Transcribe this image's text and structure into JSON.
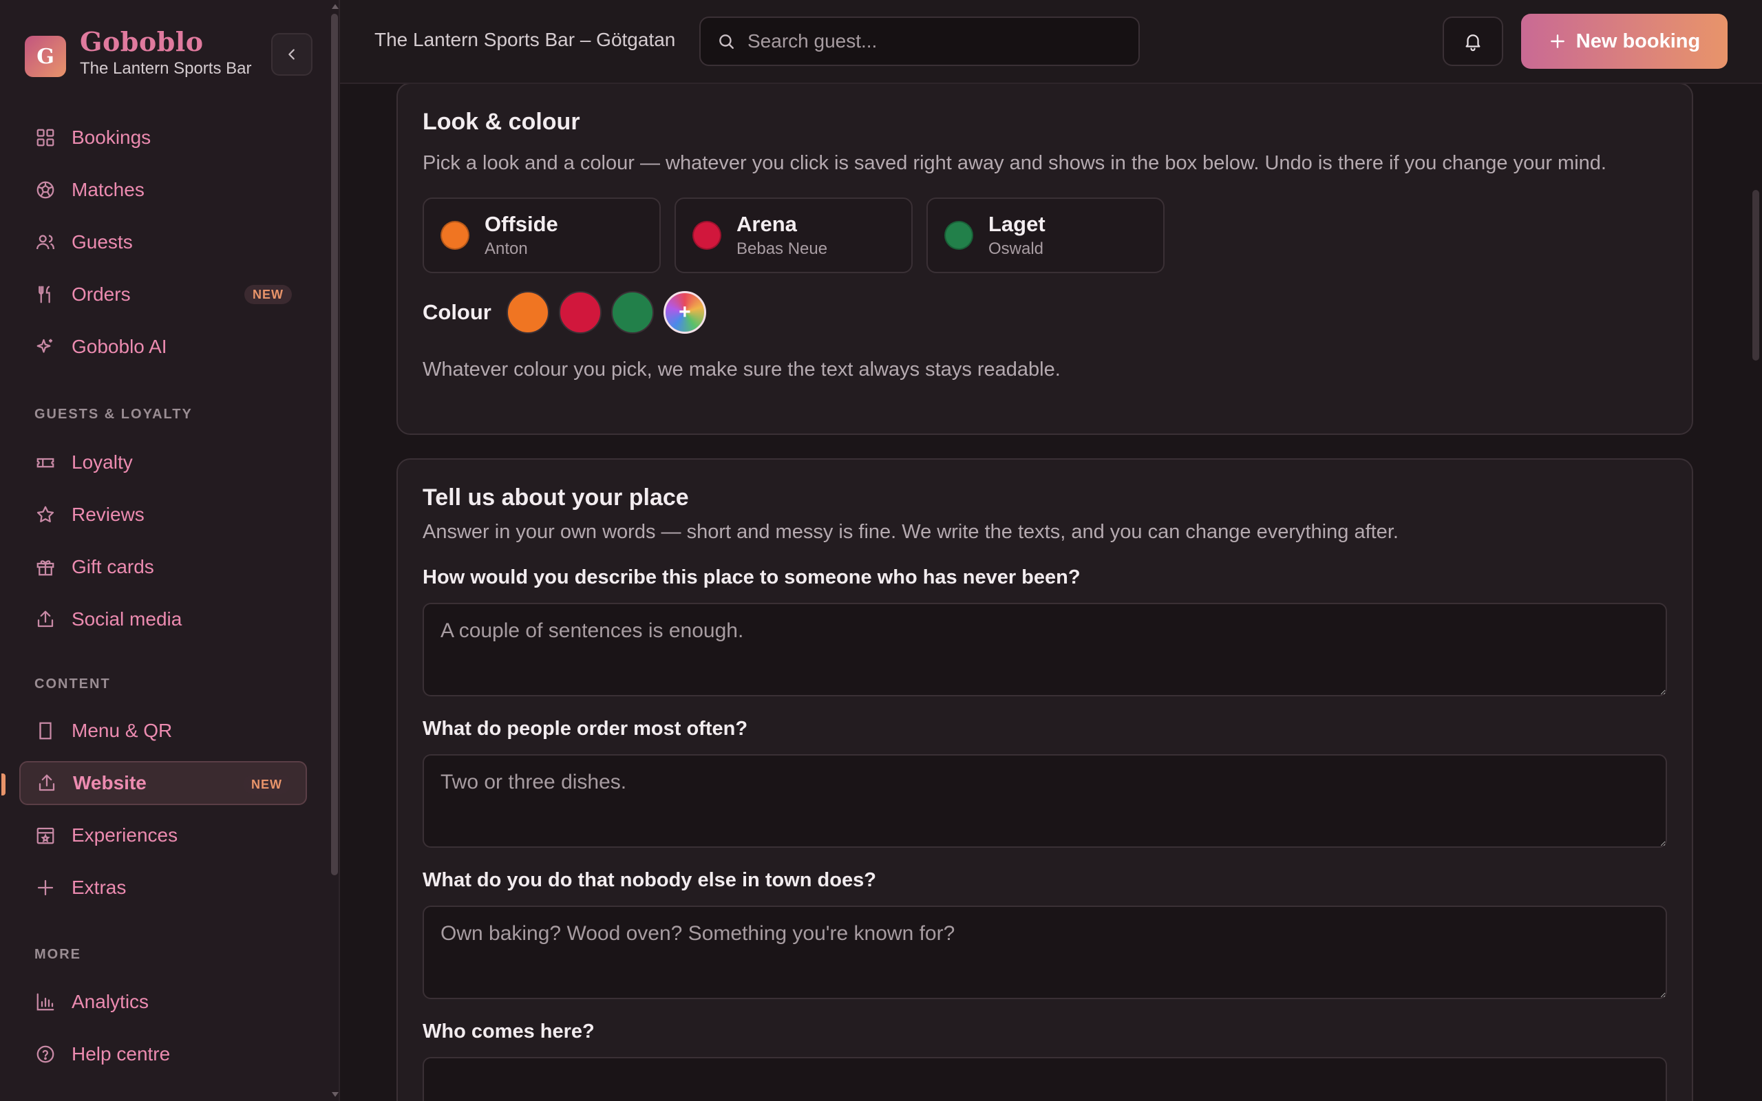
{
  "sidebar": {
    "brand_initial": "G",
    "brand_name": "Goboblo",
    "brand_sub": "The Lantern Sports Bar",
    "primary": [
      {
        "label": "Bookings",
        "icon": "grid-icon"
      },
      {
        "label": "Matches",
        "icon": "football-icon"
      },
      {
        "label": "Guests",
        "icon": "users-icon"
      },
      {
        "label": "Orders",
        "icon": "cutlery-icon",
        "badge": "NEW"
      },
      {
        "label": "Goboblo AI",
        "icon": "sparkle-icon"
      }
    ],
    "section_guests": "GUESTS & LOYALTY",
    "guests_items": [
      {
        "label": "Loyalty",
        "icon": "ticket-icon"
      },
      {
        "label": "Reviews",
        "icon": "star-icon"
      },
      {
        "label": "Gift cards",
        "icon": "gift-icon"
      },
      {
        "label": "Social media",
        "icon": "share-icon"
      }
    ],
    "section_content": "CONTENT",
    "content_items": [
      {
        "label": "Menu & QR",
        "icon": "book-icon"
      },
      {
        "label": "Website",
        "icon": "upload-icon",
        "badge": "NEW",
        "active": true
      },
      {
        "label": "Experiences",
        "icon": "calendar-star-icon"
      },
      {
        "label": "Extras",
        "icon": "plus-icon"
      }
    ],
    "section_more": "MORE",
    "more_items": [
      {
        "label": "Analytics",
        "icon": "bar-chart-icon"
      },
      {
        "label": "Help centre",
        "icon": "help-icon"
      }
    ]
  },
  "topbar": {
    "venue": "The Lantern Sports Bar – Götgatan",
    "search_placeholder": "Search guest...",
    "new_booking": "New booking"
  },
  "look": {
    "title": "Look & colour",
    "desc": "Pick a look and a colour — whatever you click is saved right away and shows in the box below. Undo is there if you change your mind.",
    "options": [
      {
        "name": "Offside",
        "font": "Anton",
        "color": "#f07522"
      },
      {
        "name": "Arena",
        "font": "Bebas Neue",
        "color": "#d1173c"
      },
      {
        "name": "Laget",
        "font": "Oswald",
        "color": "#22804a"
      }
    ],
    "colour_label": "Colour",
    "swatches": [
      "#f07522",
      "#d1173c",
      "#22804a"
    ],
    "custom_symbol": "+",
    "note": "Whatever colour you pick, we make sure the text always stays readable."
  },
  "tell": {
    "title": "Tell us about your place",
    "desc": "Answer in your own words — short and messy is fine. We write the texts, and you can change everything after.",
    "questions": [
      {
        "q": "How would you describe this place to someone who has never been?",
        "placeholder": "A couple of sentences is enough."
      },
      {
        "q": "What do people order most often?",
        "placeholder": "Two or three dishes."
      },
      {
        "q": "What do you do that nobody else in town does?",
        "placeholder": "Own baking? Wood oven? Something you're known for?"
      },
      {
        "q": "Who comes here?",
        "placeholder": ""
      }
    ]
  }
}
